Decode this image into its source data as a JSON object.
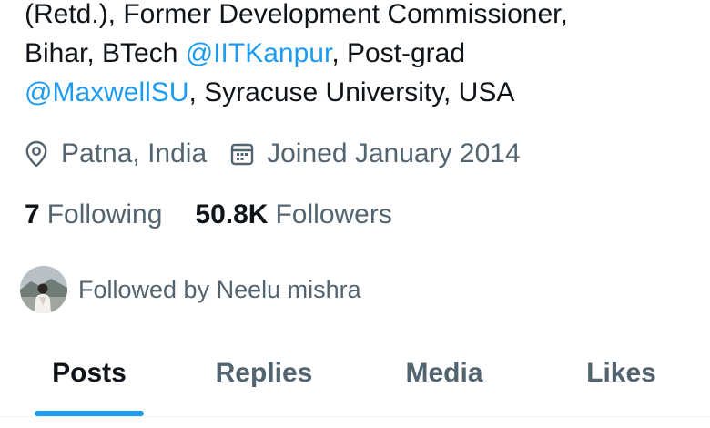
{
  "bio": {
    "line1": "(Retd.), Former Development Commissioner,",
    "line2_prefix": "Bihar, BTech ",
    "line2_mention": "@IITKanpur",
    "line2_suffix": ", Post-grad",
    "line3_mention": "@MaxwellSU",
    "line3_suffix": ", Syracuse University, USA"
  },
  "meta": {
    "location_icon": "location-pin-icon",
    "location": "Patna, India",
    "joined_icon": "calendar-icon",
    "joined": "Joined January 2014"
  },
  "stats": {
    "following_count": "7",
    "following_label": "Following",
    "followers_count": "50.8K",
    "followers_label": "Followers"
  },
  "followed_by": {
    "text": "Followed by Neelu mishra"
  },
  "tabs": [
    {
      "label": "Posts",
      "active": true
    },
    {
      "label": "Replies",
      "active": false
    },
    {
      "label": "Media",
      "active": false
    },
    {
      "label": "Likes",
      "active": false
    }
  ],
  "colors": {
    "accent": "#1d9bf0",
    "primary_text": "#0f1419",
    "secondary_text": "#536471"
  }
}
